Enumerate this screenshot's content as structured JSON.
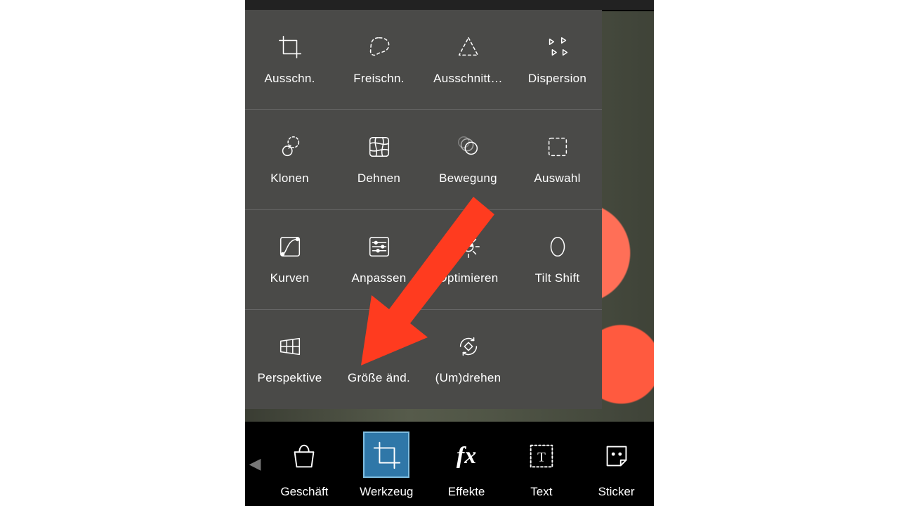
{
  "panel": {
    "rows": [
      [
        {
          "label": "Ausschn.",
          "icon": "crop"
        },
        {
          "label": "Freischn.",
          "icon": "lasso"
        },
        {
          "label": "Ausschnitt…",
          "icon": "shape-cut"
        },
        {
          "label": "Dispersion",
          "icon": "dispersion"
        }
      ],
      [
        {
          "label": "Klonen",
          "icon": "clone"
        },
        {
          "label": "Dehnen",
          "icon": "stretch"
        },
        {
          "label": "Bewegung",
          "icon": "motion"
        },
        {
          "label": "Auswahl",
          "icon": "selection"
        }
      ],
      [
        {
          "label": "Kurven",
          "icon": "curves"
        },
        {
          "label": "Anpassen",
          "icon": "adjust"
        },
        {
          "label": "Optimieren",
          "icon": "enhance"
        },
        {
          "label": "Tilt Shift",
          "icon": "tilt-shift"
        }
      ],
      [
        {
          "label": "Perspektive",
          "icon": "perspective"
        },
        {
          "label": "Größe änd.",
          "icon": "resize"
        },
        {
          "label": "(Um)drehen",
          "icon": "flip-rotate"
        },
        {
          "label": "",
          "icon": ""
        }
      ]
    ]
  },
  "nav": {
    "items": [
      {
        "label": "Geschäft",
        "icon": "shop",
        "active": false
      },
      {
        "label": "Werkzeug",
        "icon": "crop",
        "active": true
      },
      {
        "label": "Effekte",
        "icon": "fx",
        "active": false
      },
      {
        "label": "Text",
        "icon": "text",
        "active": false
      },
      {
        "label": "Sticker",
        "icon": "sticker",
        "active": false,
        "truncated": true
      }
    ]
  },
  "annotation": {
    "type": "arrow",
    "color": "#ff3b1f",
    "target": "resize"
  }
}
